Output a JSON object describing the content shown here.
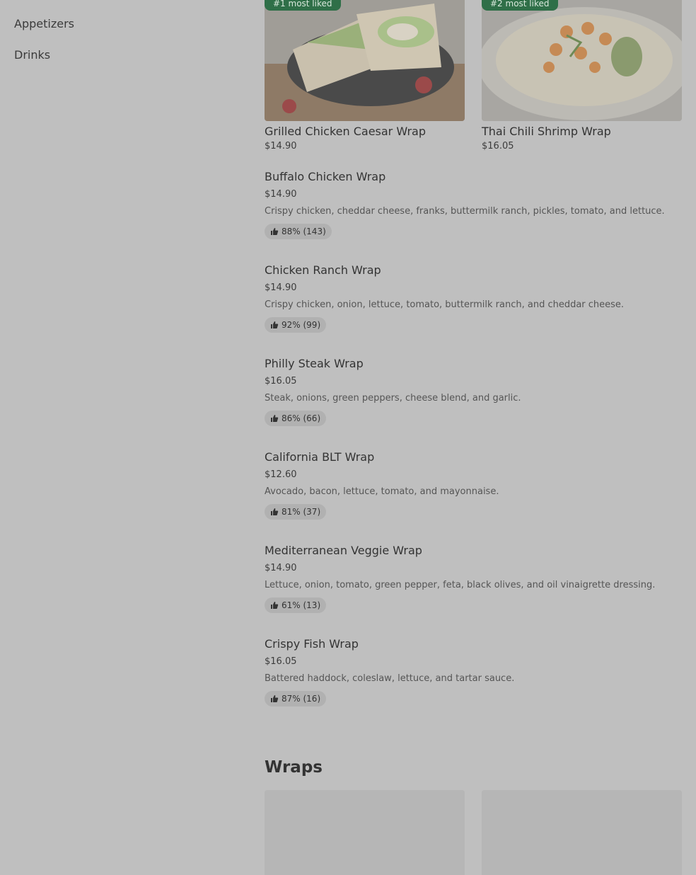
{
  "sidebar": {
    "items": [
      {
        "label": "Appetizers"
      },
      {
        "label": "Drinks"
      }
    ]
  },
  "featured": [
    {
      "badge": "#1 most liked",
      "name": "Grilled Chicken Caesar Wrap",
      "price": "$14.90"
    },
    {
      "badge": "#2 most liked",
      "name": "Thai Chili Shrimp Wrap",
      "price": "$16.05"
    }
  ],
  "items": [
    {
      "name": "Buffalo Chicken Wrap",
      "price": "$14.90",
      "description": "Crispy chicken, cheddar cheese, franks, buttermilk ranch, pickles, tomato, and lettuce.",
      "rating": "88% (143)"
    },
    {
      "name": "Chicken Ranch Wrap",
      "price": "$14.90",
      "description": "Crispy chicken, onion, lettuce, tomato, buttermilk ranch, and cheddar cheese.",
      "rating": "92% (99)"
    },
    {
      "name": "Philly Steak Wrap",
      "price": "$16.05",
      "description": "Steak, onions, green peppers, cheese blend, and garlic.",
      "rating": "86% (66)"
    },
    {
      "name": "California BLT Wrap",
      "price": "$12.60",
      "description": "Avocado, bacon, lettuce, tomato, and mayonnaise.",
      "rating": "81% (37)"
    },
    {
      "name": "Mediterranean Veggie Wrap",
      "price": "$14.90",
      "description": "Lettuce, onion, tomato, green pepper, feta, black olives, and oil vinaigrette dressing.",
      "rating": "61% (13)"
    },
    {
      "name": "Crispy Fish Wrap",
      "price": "$16.05",
      "description": "Battered haddock, coleslaw, lettuce, and tartar sauce.",
      "rating": "87% (16)"
    }
  ],
  "section": {
    "title": "Wraps"
  },
  "colors": {
    "badge": "#2f6f48",
    "overlay": "#bfbfbf"
  },
  "icons": {
    "rating": "thumbs-up-icon"
  }
}
